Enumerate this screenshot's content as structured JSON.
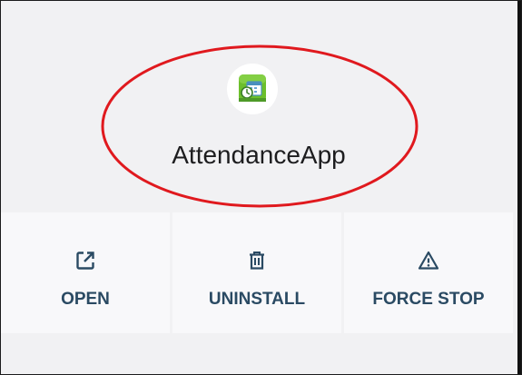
{
  "app": {
    "name": "AttendanceApp",
    "icon": "attendance-app-icon"
  },
  "actions": [
    {
      "label": "OPEN",
      "icon": "open-external-icon"
    },
    {
      "label": "UNINSTALL",
      "icon": "trash-icon"
    },
    {
      "label": "FORCE STOP",
      "icon": "warning-triangle-icon"
    }
  ],
  "colors": {
    "background": "#f1f1f3",
    "button_background": "#f8f8fa",
    "action_color": "#2a4a63",
    "highlight_ellipse": "#e0191e"
  }
}
